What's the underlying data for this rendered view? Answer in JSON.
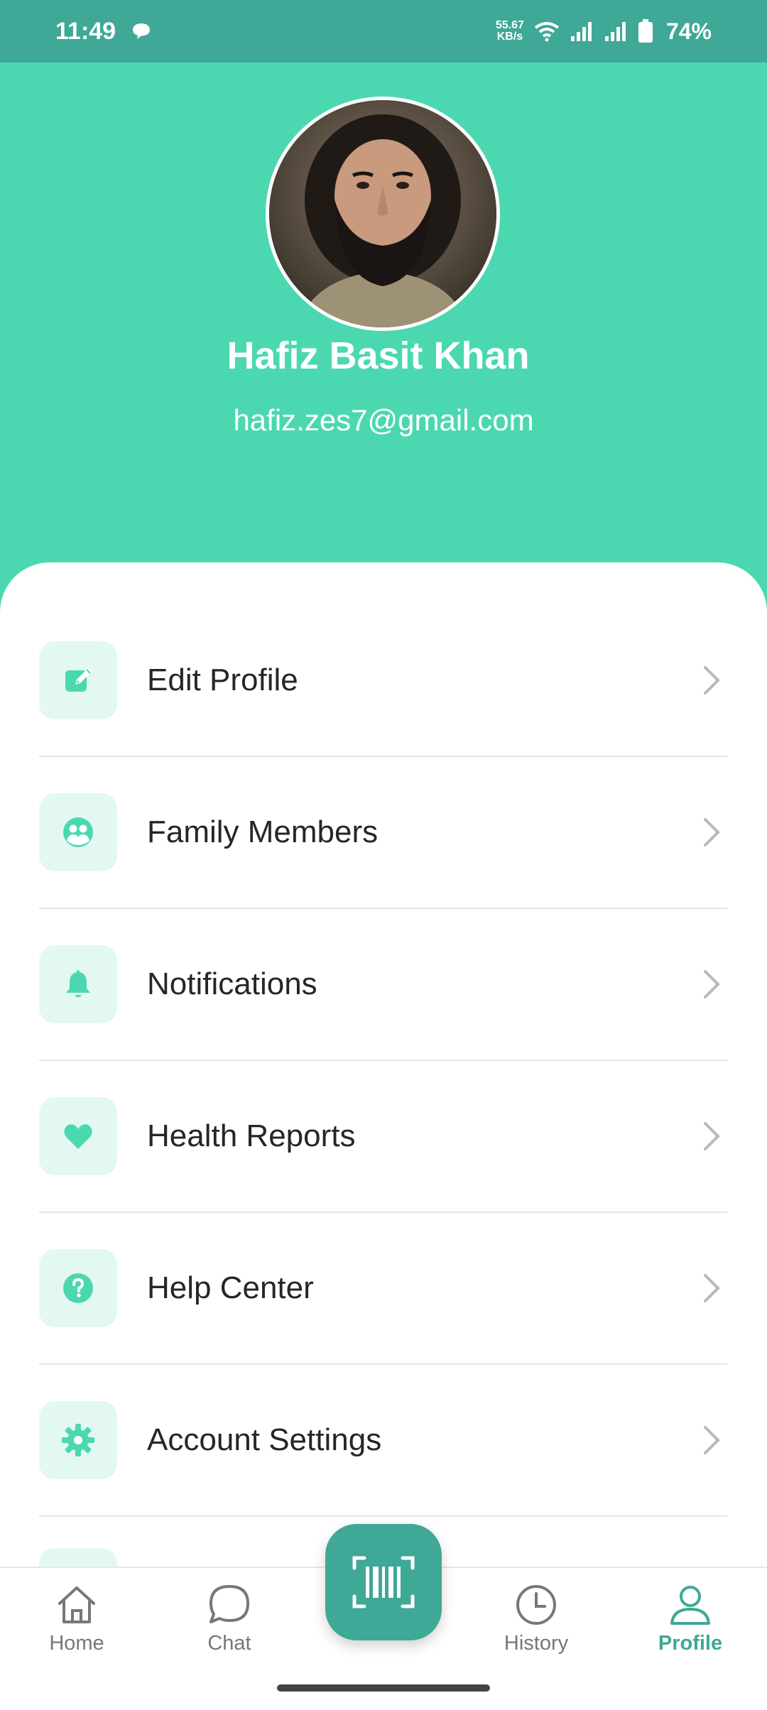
{
  "status_bar": {
    "time": "11:49",
    "net_speed_value": "55.67",
    "net_speed_unit": "KB/s",
    "battery": "74%"
  },
  "profile": {
    "name": "Hafiz Basit Khan",
    "email": "hafiz.zes7@gmail.com"
  },
  "menu": {
    "items": [
      {
        "label": "Edit Profile",
        "icon": "edit-icon"
      },
      {
        "label": "Family Members",
        "icon": "family-icon"
      },
      {
        "label": "Notifications",
        "icon": "bell-icon"
      },
      {
        "label": "Health Reports",
        "icon": "heart-icon"
      },
      {
        "label": "Help Center",
        "icon": "help-icon"
      },
      {
        "label": "Account Settings",
        "icon": "gear-icon"
      }
    ]
  },
  "bottom_nav": {
    "items": [
      {
        "label": "Home",
        "icon": "home-icon"
      },
      {
        "label": "Chat",
        "icon": "chat-icon"
      },
      {
        "label": "History",
        "icon": "clock-icon"
      },
      {
        "label": "Profile",
        "icon": "user-icon",
        "active": true
      }
    ],
    "center_action_icon": "barcode-scan-icon"
  },
  "colors": {
    "accent": "#4bd8b0",
    "accent_dark": "#3fa896",
    "icon_bg": "#e4f8f2"
  }
}
